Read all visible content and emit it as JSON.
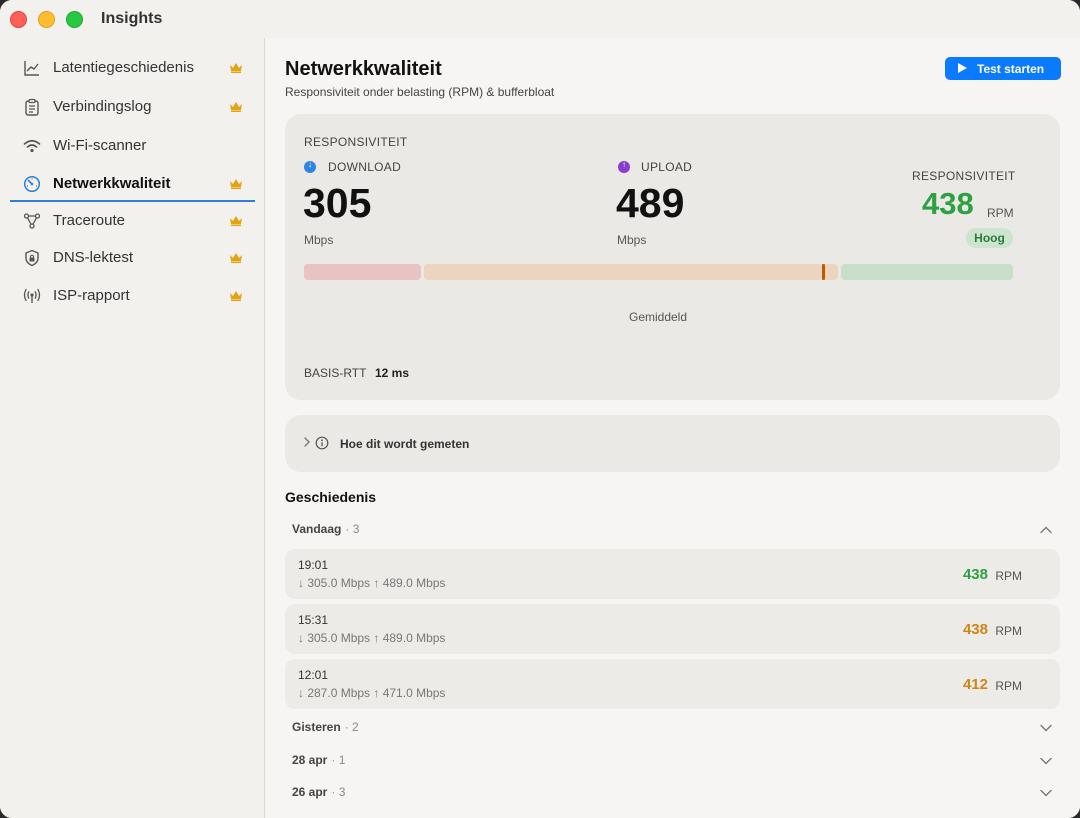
{
  "app": {
    "title": "Insights"
  },
  "sidebar": {
    "items": [
      {
        "label": "Latentiegeschiedenis",
        "icon": "chart-line-icon",
        "premium": true,
        "active": false
      },
      {
        "label": "Verbindingslog",
        "icon": "clipboard-icon",
        "premium": true,
        "active": false
      },
      {
        "label": "Wi-Fi-scanner",
        "icon": "wifi-icon",
        "premium": false,
        "active": false
      },
      {
        "label": "Netwerkkwaliteit",
        "icon": "gauge-icon",
        "premium": true,
        "active": true
      },
      {
        "label": "Traceroute",
        "icon": "network-nodes-icon",
        "premium": true,
        "active": false
      },
      {
        "label": "DNS-lektest",
        "icon": "shield-lock-icon",
        "premium": true,
        "active": false
      },
      {
        "label": "ISP-rapport",
        "icon": "antenna-icon",
        "premium": true,
        "active": false
      }
    ],
    "premium_icon": "crown-icon"
  },
  "main": {
    "title": "Netwerkkwaliteit",
    "subtitle": "Responsiviteit onder belasting (RPM) & bufferbloat",
    "start_button": "Test starten",
    "summary": {
      "caption": "RESPONSIVITEIT",
      "download": {
        "label": "DOWNLOAD",
        "value": "305",
        "unit": "Mbps"
      },
      "upload": {
        "label": "UPLOAD",
        "value": "489",
        "unit": "Mbps"
      },
      "responsiveness": {
        "label": "RESPONSIVITEIT",
        "value": "438",
        "unit": "RPM",
        "badge": "Hoog"
      },
      "scale": {
        "label": "Gemiddeld",
        "marker_position": 0.73,
        "colors": {
          "low": "#e8c3c1",
          "mid": "#ecd4bf",
          "high": "#c9dfc9",
          "marker": "#c15a07"
        }
      },
      "base_rtt": {
        "label": "BASIS-RTT",
        "value": "12 ms"
      }
    },
    "how_measured": "Hoe dit wordt gemeten",
    "history": {
      "title": "Geschiedenis",
      "groups": [
        {
          "name": "Vandaag",
          "count": "· 3",
          "expanded": true
        },
        {
          "name": "Gisteren",
          "count": "· 2",
          "expanded": false
        },
        {
          "name": "28 apr",
          "count": "· 1",
          "expanded": false
        },
        {
          "name": "26 apr",
          "count": "· 3",
          "expanded": false
        }
      ],
      "rows": [
        {
          "time": "19:01",
          "speeds": "↓ 305.0 Mbps  ↑ 489.0 Mbps",
          "rpm": "438",
          "unit": "RPM",
          "color": "#2ea043"
        },
        {
          "time": "15:31",
          "speeds": "↓ 305.0 Mbps  ↑ 489.0 Mbps",
          "rpm": "438",
          "unit": "RPM",
          "color": "#d0841a"
        },
        {
          "time": "12:01",
          "speeds": "↓ 287.0 Mbps  ↑ 471.0 Mbps",
          "rpm": "412",
          "unit": "RPM",
          "color": "#d0841a"
        }
      ]
    }
  }
}
